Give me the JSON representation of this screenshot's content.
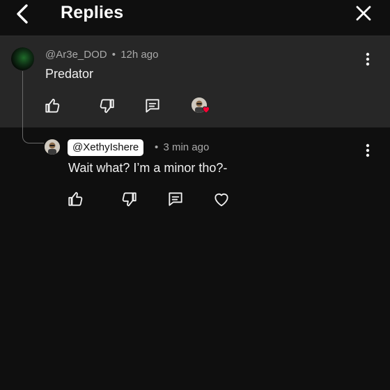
{
  "header": {
    "title": "Replies"
  },
  "parent_comment": {
    "author": "@Ar3e_DOD",
    "separator": "•",
    "time": "12h ago",
    "text": "Predator"
  },
  "reply": {
    "mention": "@XethyIshere",
    "separator": "•",
    "time": "3 min ago",
    "text": "Wait what? I’m a minor tho?-"
  },
  "colors": {
    "background": "#0f0f0f",
    "highlight": "#272727",
    "heart": "#ff0033",
    "meta_text": "#aaaaaa"
  },
  "icons": {
    "back": "chevron-left-icon",
    "close": "close-icon",
    "like": "thumbs-up-icon",
    "dislike": "thumbs-down-icon",
    "reply": "comment-icon",
    "heart": "heart-icon",
    "more": "more-vertical-icon"
  }
}
